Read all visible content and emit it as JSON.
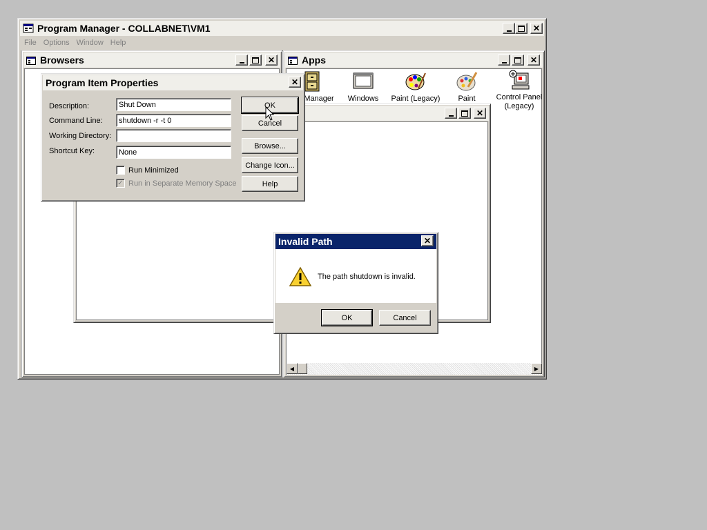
{
  "program_manager": {
    "title": "Program Manager - COLLABNET\\VM1",
    "menu": [
      "File",
      "Options",
      "Window",
      "Help"
    ]
  },
  "browsers_window": {
    "title": "Browsers"
  },
  "apps_window": {
    "title": "Apps",
    "icons": [
      {
        "label": "Manager",
        "icon": "file-cabinet-icon"
      },
      {
        "label": "Windows",
        "icon": "window-icon"
      },
      {
        "label": "Paint (Legacy)",
        "icon": "palette-icon"
      },
      {
        "label": "Paint",
        "icon": "palette-brush-icon"
      },
      {
        "label": "Control Panel (Legacy)",
        "icon": "control-panel-icon"
      }
    ]
  },
  "properties_dialog": {
    "title": "Program Item Properties",
    "description_label": "Description:",
    "description_value": "Shut Down",
    "command_line_label": "Command Line:",
    "command_line_value": "shutdown -r -t 0",
    "working_directory_label": "Working Directory:",
    "working_directory_value": "",
    "shortcut_key_label": "Shortcut Key:",
    "shortcut_key_value": "None",
    "run_minimized_label": "Run Minimized",
    "run_minimized_checked": false,
    "separate_memory_label": "Run in Separate Memory Space",
    "separate_memory_checked": true,
    "ok_label": "OK",
    "cancel_label": "Cancel",
    "browse_label": "Browse...",
    "change_icon_label": "Change Icon...",
    "help_label": "Help"
  },
  "error_dialog": {
    "title": "Invalid Path",
    "message": "The path shutdown is invalid.",
    "icon": "warning-icon",
    "ok_label": "OK",
    "cancel_label": "Cancel"
  },
  "colors": {
    "desktop": "#c0c0c0",
    "active_title": "#0a246a",
    "inactive_title": "#f0efea"
  }
}
